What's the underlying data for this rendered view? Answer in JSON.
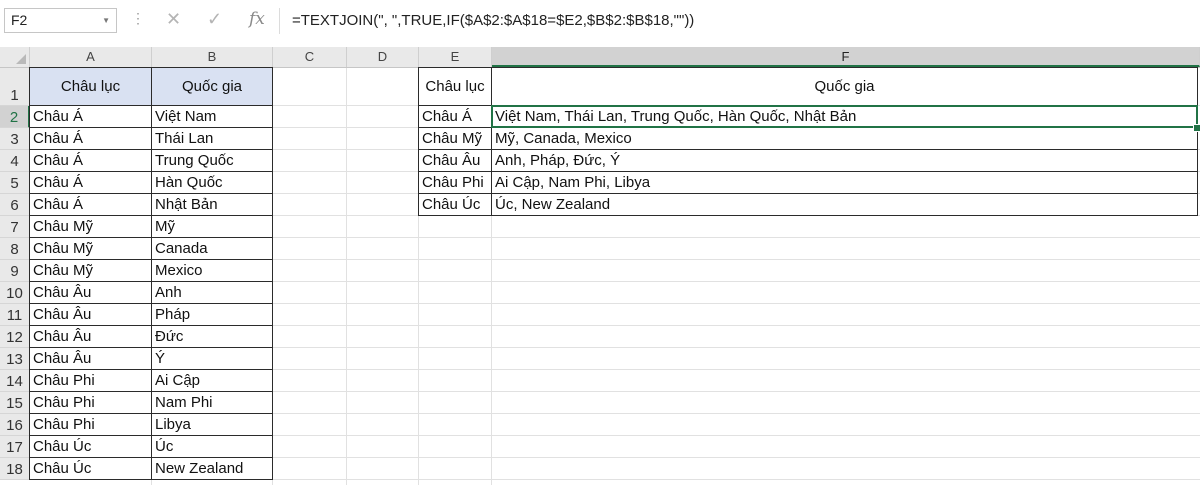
{
  "formula_bar": {
    "name_box": "F2",
    "formula": "=TEXTJOIN(\", \",TRUE,IF($A$2:$A$18=$E2,$B$2:$B$18,\"\"))",
    "icons": [
      "cancel-icon",
      "enter-icon",
      "fx-icon"
    ]
  },
  "columns": [
    "A",
    "B",
    "C",
    "D",
    "E",
    "F"
  ],
  "selected_column": "F",
  "selected_row": "2",
  "rows": [
    "1",
    "2",
    "3",
    "4",
    "5",
    "6",
    "7",
    "8",
    "9",
    "10",
    "11",
    "12",
    "13",
    "14",
    "15",
    "16",
    "17",
    "18"
  ],
  "table1": {
    "headers": [
      "Châu lục",
      "Quốc gia"
    ],
    "rows": [
      [
        "Châu Á",
        "Việt Nam"
      ],
      [
        "Châu Á",
        "Thái Lan"
      ],
      [
        "Châu Á",
        "Trung Quốc"
      ],
      [
        "Châu Á",
        "Hàn Quốc"
      ],
      [
        "Châu Á",
        "Nhật Bản"
      ],
      [
        "Châu Mỹ",
        "Mỹ"
      ],
      [
        "Châu Mỹ",
        "Canada"
      ],
      [
        "Châu Mỹ",
        "Mexico"
      ],
      [
        "Châu Âu",
        "Anh"
      ],
      [
        "Châu Âu",
        "Pháp"
      ],
      [
        "Châu Âu",
        "Đức"
      ],
      [
        "Châu Âu",
        "Ý"
      ],
      [
        "Châu Phi",
        "Ai Cập"
      ],
      [
        "Châu Phi",
        "Nam Phi"
      ],
      [
        "Châu Phi",
        "Libya"
      ],
      [
        "Châu Úc",
        "Úc"
      ],
      [
        "Châu Úc",
        "New Zealand"
      ]
    ]
  },
  "table2": {
    "headers": [
      "Châu lục",
      "Quốc gia"
    ],
    "rows": [
      [
        "Châu Á",
        "Việt Nam, Thái Lan, Trung Quốc, Hàn Quốc, Nhật Bản"
      ],
      [
        "Châu Mỹ",
        "Mỹ, Canada, Mexico"
      ],
      [
        "Châu Âu",
        "Anh, Pháp, Đức, Ý"
      ],
      [
        "Châu Phi",
        "Ai Cập, Nam Phi, Libya"
      ],
      [
        "Châu Úc",
        "Úc, New Zealand"
      ]
    ]
  },
  "colors": {
    "accent": "#217346",
    "header_fill": "#d9e1f2"
  }
}
